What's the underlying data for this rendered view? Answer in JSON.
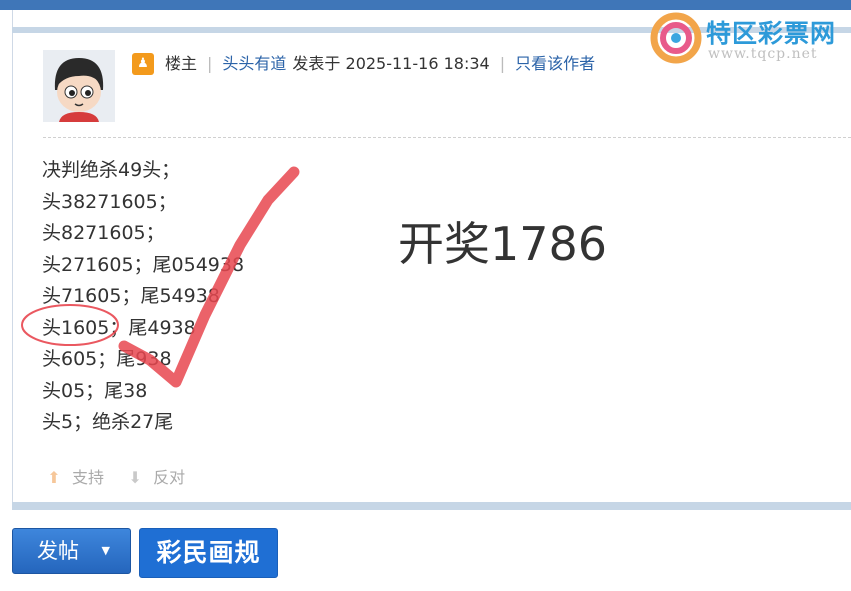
{
  "post": {
    "badge_icon": "user-badge-icon",
    "owner_label": "楼主",
    "author": "头头有道",
    "posted_at": "发表于 2025-11-16 18:34",
    "only_author_link": "只看该作者",
    "lines": [
      "决判绝杀49头；",
      "头38271605；",
      "头8271605；",
      "头271605；尾054938",
      "头71605；尾54938",
      "头1605；尾4938",
      "头605；尾938",
      "头05；尾38",
      "头5；绝杀27尾"
    ],
    "draw_result": "开奖1786"
  },
  "actions": {
    "support_label": "支持",
    "oppose_label": "反对"
  },
  "buttons": {
    "post_label": "发帖",
    "rules_label": "彩民画规"
  },
  "watermark": {
    "brand": "特区彩票网",
    "url": "www.tqcp.net"
  },
  "colors": {
    "accent": "#2b63a8",
    "button_blue": "#2566bd",
    "annotation_red": "#e8464f",
    "owner_badge": "#f39a1c"
  }
}
